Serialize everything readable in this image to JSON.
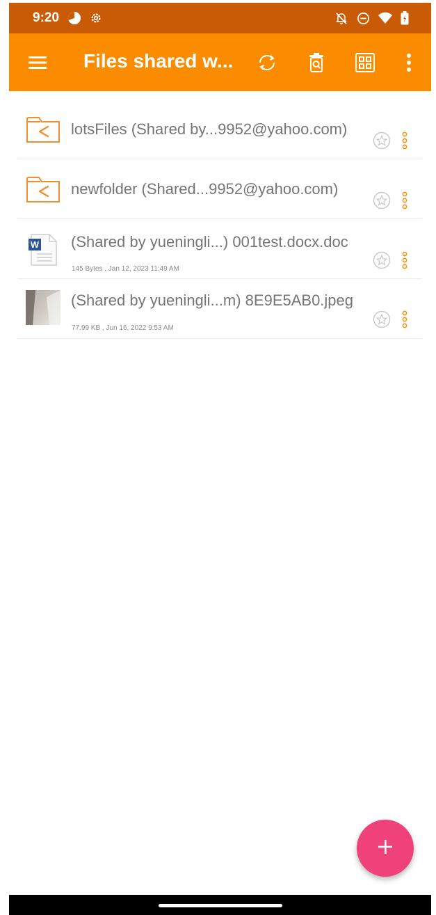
{
  "status_bar": {
    "time": "9:20",
    "icons": [
      "pie-chart-icon",
      "gear-icon",
      "notifications-off-icon",
      "do-not-disturb-icon",
      "wifi-icon",
      "battery-icon"
    ]
  },
  "app_bar": {
    "title": "Files shared w...",
    "actions": [
      "menu-icon",
      "sync-icon",
      "trash-search-icon",
      "grid-view-icon",
      "more-vert-icon"
    ]
  },
  "files": [
    {
      "name": "lotsFiles (Shared by...9952@yahoo.com)",
      "meta": "",
      "type": "shared-folder"
    },
    {
      "name": "newfolder (Shared...9952@yahoo.com)",
      "meta": "",
      "type": "shared-folder"
    },
    {
      "name": "(Shared by yueningli...) 001test.docx.doc",
      "meta": "145 Bytes , Jan 12, 2023 11:49 AM",
      "type": "word-doc"
    },
    {
      "name": "(Shared by yueningli...m) 8E9E5AB0.jpeg",
      "meta": "77.99 KB , Jun 16, 2022 9:53 AM",
      "type": "image"
    }
  ],
  "fab": {
    "icon": "plus-icon"
  },
  "colors": {
    "status_bar": "#c95b06",
    "app_bar": "#fb8c00",
    "accent": "#fb8c00",
    "fab": "#f0427a"
  }
}
